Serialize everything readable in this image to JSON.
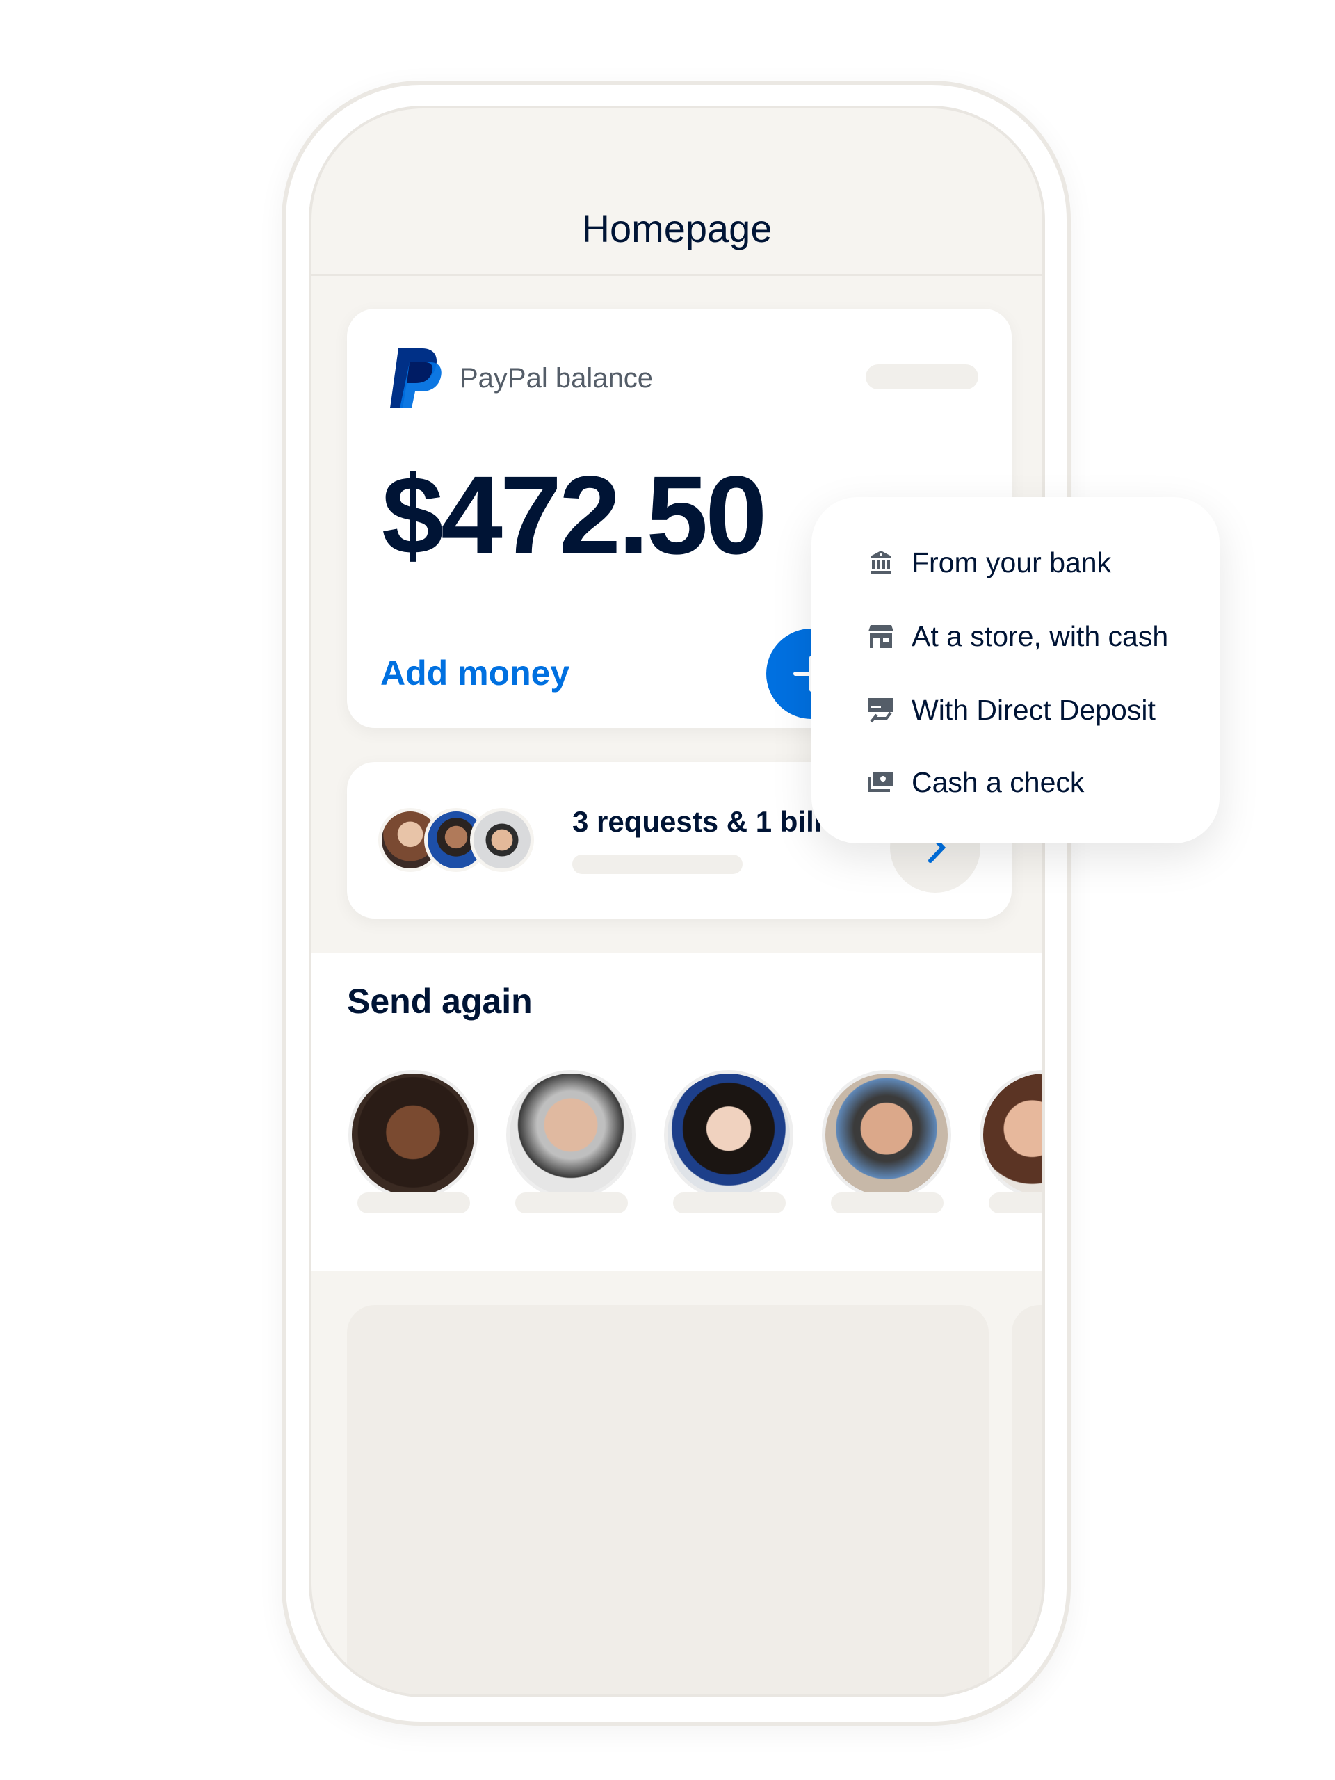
{
  "header": {
    "title": "Homepage"
  },
  "balance_card": {
    "label": "PayPal balance",
    "amount": "$472.50",
    "add_money_label": "Add money",
    "add_button_icon": "plus-icon",
    "logo_icon": "paypal-logo-icon"
  },
  "requests_card": {
    "text": "3 requests & 1 bill",
    "chevron_icon": "chevron-right-icon"
  },
  "send_again": {
    "title": "Send again"
  },
  "add_money_menu": {
    "items": [
      {
        "label": "From your bank",
        "icon": "bank-icon"
      },
      {
        "label": "At a store, with cash",
        "icon": "store-icon"
      },
      {
        "label": "With Direct Deposit",
        "icon": "direct-deposit-icon"
      },
      {
        "label": "Cash a check",
        "icon": "check-icon"
      }
    ]
  },
  "colors": {
    "accent": "#0070e0",
    "text": "#001435",
    "muted": "#545d68",
    "background": "#f6f4f0"
  }
}
